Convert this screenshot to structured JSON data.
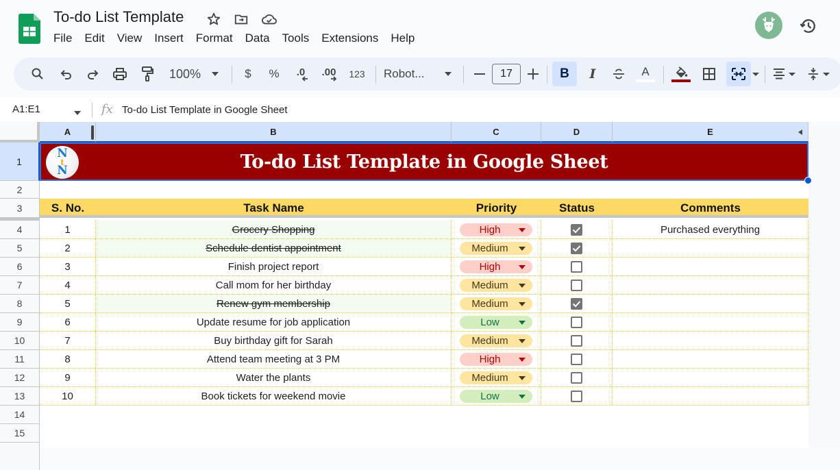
{
  "app": {
    "doc_title": "To-do List Template",
    "menu": [
      "File",
      "Edit",
      "View",
      "Insert",
      "Format",
      "Data",
      "Tools",
      "Extensions",
      "Help"
    ]
  },
  "toolbar": {
    "zoom": "100%",
    "currency": "$",
    "percent": "%",
    "decrease_decimal": ".0",
    "increase_decimal": ".00",
    "number_format": "123",
    "font": "Robot...",
    "font_size": "17",
    "bold": "B",
    "italic": "I",
    "text_color_letter": "A",
    "fill_color": "#990000",
    "text_color": "#ffffff"
  },
  "formula_bar": {
    "cell_range": "A1:E1",
    "fx": "fx",
    "content": "To-do List Template in Google Sheet"
  },
  "columns": [
    "A",
    "B",
    "C",
    "D",
    "E"
  ],
  "row_numbers": [
    "1",
    "2",
    "3",
    "4",
    "5",
    "6",
    "7",
    "8",
    "9",
    "10",
    "11",
    "12",
    "13",
    "14",
    "15"
  ],
  "sheet": {
    "banner_title": "To-do List Template in Google Sheet",
    "logo_letters": [
      "N",
      "t",
      "N"
    ],
    "headers": [
      "S. No.",
      "Task Name",
      "Priority",
      "Status",
      "Comments"
    ],
    "tasks": [
      {
        "no": "1",
        "name": "Grocery Shopping",
        "priority": "High",
        "done": true,
        "comment": "Purchased everything"
      },
      {
        "no": "2",
        "name": "Schedule dentist appointment",
        "priority": "Medium",
        "done": true,
        "comment": ""
      },
      {
        "no": "3",
        "name": "Finish project report",
        "priority": "High",
        "done": false,
        "comment": ""
      },
      {
        "no": "4",
        "name": "Call mom for her birthday",
        "priority": "Medium",
        "done": false,
        "comment": ""
      },
      {
        "no": "5",
        "name": "Renew gym membership",
        "priority": "Medium",
        "done": true,
        "comment": ""
      },
      {
        "no": "6",
        "name": "Update resume for job application",
        "priority": "Low",
        "done": false,
        "comment": ""
      },
      {
        "no": "7",
        "name": "Buy birthday gift for Sarah",
        "priority": "Medium",
        "done": false,
        "comment": ""
      },
      {
        "no": "8",
        "name": "Attend team meeting at 3 PM",
        "priority": "High",
        "done": false,
        "comment": ""
      },
      {
        "no": "9",
        "name": "Water the plants",
        "priority": "Medium",
        "done": false,
        "comment": ""
      },
      {
        "no": "10",
        "name": "Book tickets for weekend movie",
        "priority": "Low",
        "done": false,
        "comment": ""
      }
    ]
  },
  "colors": {
    "banner_bg": "#990000",
    "header_bg": "#ffd966",
    "high_chip": "#ffcfc9",
    "medium_chip": "#ffe5a0",
    "low_chip": "#d4edbc",
    "selection": "#0b57d0"
  }
}
